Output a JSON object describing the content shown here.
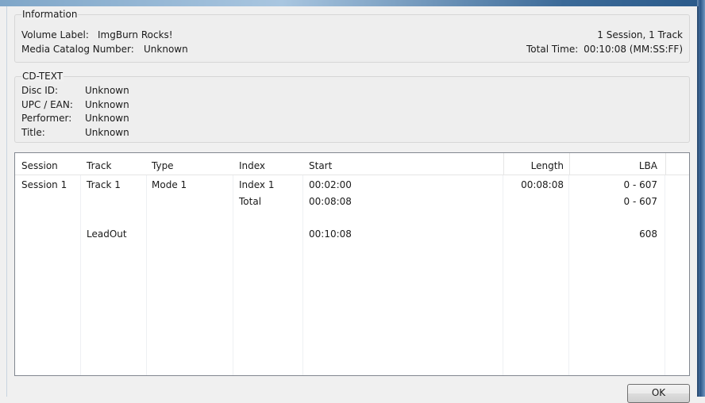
{
  "information": {
    "title": "Information",
    "volume_label_key": "Volume Label:",
    "volume_label": "ImgBurn Rocks!",
    "mcn_key": "Media Catalog Number:",
    "mcn": "Unknown",
    "sessions": "1 Session, 1 Track",
    "total_time_key": "Total Time:",
    "total_time": "00:10:08 (MM:SS:FF)"
  },
  "cdtext": {
    "title": "CD-TEXT",
    "fields": [
      {
        "key": "Disc ID:",
        "value": "Unknown"
      },
      {
        "key": "UPC / EAN:",
        "value": "Unknown"
      },
      {
        "key": "Performer:",
        "value": "Unknown"
      },
      {
        "key": "Title:",
        "value": "Unknown"
      }
    ]
  },
  "table": {
    "headers": [
      "Session",
      "Track",
      "Type",
      "Index",
      "Start",
      "Length",
      "LBA"
    ],
    "rows": [
      {
        "session": "Session 1",
        "track": "Track 1",
        "type": "Mode 1",
        "index": "Index 1",
        "start": "00:02:00",
        "length": "00:08:08",
        "lba": "0 - 607"
      },
      {
        "session": "",
        "track": "",
        "type": "",
        "index": "Total",
        "start": "00:08:08",
        "length": "",
        "lba": "0 - 607"
      },
      {
        "session": "",
        "track": "",
        "type": "",
        "index": "",
        "start": "",
        "length": "",
        "lba": ""
      },
      {
        "session": "",
        "track": "LeadOut",
        "type": "",
        "index": "",
        "start": "00:10:08",
        "length": "",
        "lba": "608"
      }
    ]
  },
  "ok_label": "OK"
}
